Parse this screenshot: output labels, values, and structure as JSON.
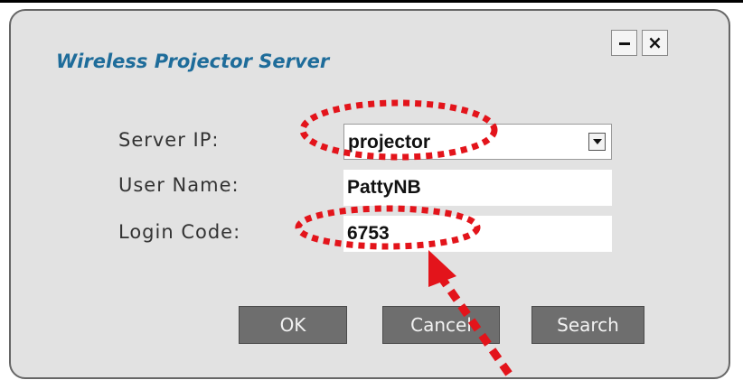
{
  "dialog": {
    "title": "Wireless Projector Server",
    "minimize_icon": "minimize-icon",
    "close_glyph": "×"
  },
  "form": {
    "server_ip_label": "Server IP:",
    "server_ip_value": "projector",
    "user_name_label": "User Name:",
    "user_name_value": "PattyNB",
    "login_code_label": "Login Code:",
    "login_code_value": "6753"
  },
  "buttons": {
    "ok": "OK",
    "cancel": "Cancel",
    "search": "Search"
  },
  "annotation": {
    "color": "#e3141b"
  }
}
